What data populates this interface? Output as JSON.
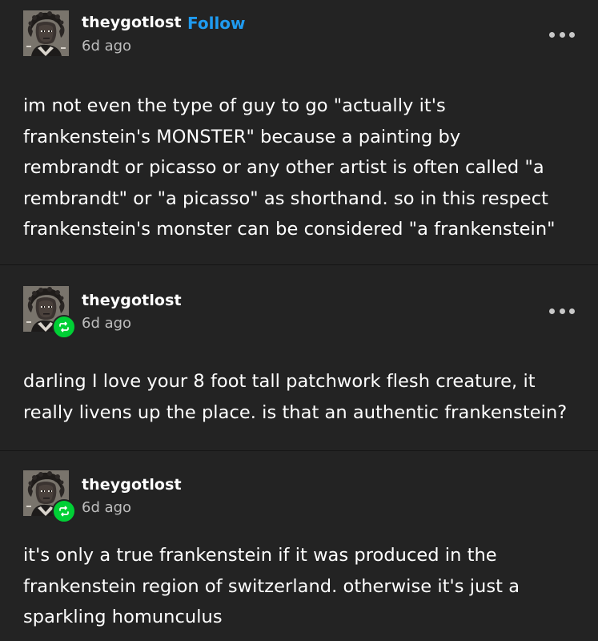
{
  "posts": [
    {
      "username": "theygotlost",
      "follow_label": "Follow",
      "time": "6d ago",
      "reblog": false,
      "lines": [
        "im not even the type of guy to go \"actually it's",
        "frankenstein's MONSTER\" because a painting by",
        "rembrandt or picasso or any other artist is often called \"a",
        "rembrandt\" or \"a picasso\" as shorthand. so in this respect",
        "frankenstein's monster can be considered \"a frankenstein\""
      ]
    },
    {
      "username": "theygotlost",
      "time": "6d ago",
      "reblog": true,
      "lines": [
        "darling I love your 8 foot tall patchwork flesh creature, it",
        "really livens up the place. is that an authentic frankenstein?"
      ]
    },
    {
      "username": "theygotlost",
      "time": "6d ago",
      "reblog": true,
      "lines": [
        "it's only a true frankenstein if it was produced in the",
        "frankenstein region of switzerland. otherwise it's just a",
        "sparkling homunculus"
      ]
    }
  ],
  "icons": {
    "more": "more-options-icon",
    "reblog": "reblog-icon",
    "avatar": "user-avatar"
  },
  "colors": {
    "background": "#232323",
    "follow": "#1f9bf0",
    "reblog_badge": "#00cf35",
    "secondary_text": "#bdbdbd"
  }
}
